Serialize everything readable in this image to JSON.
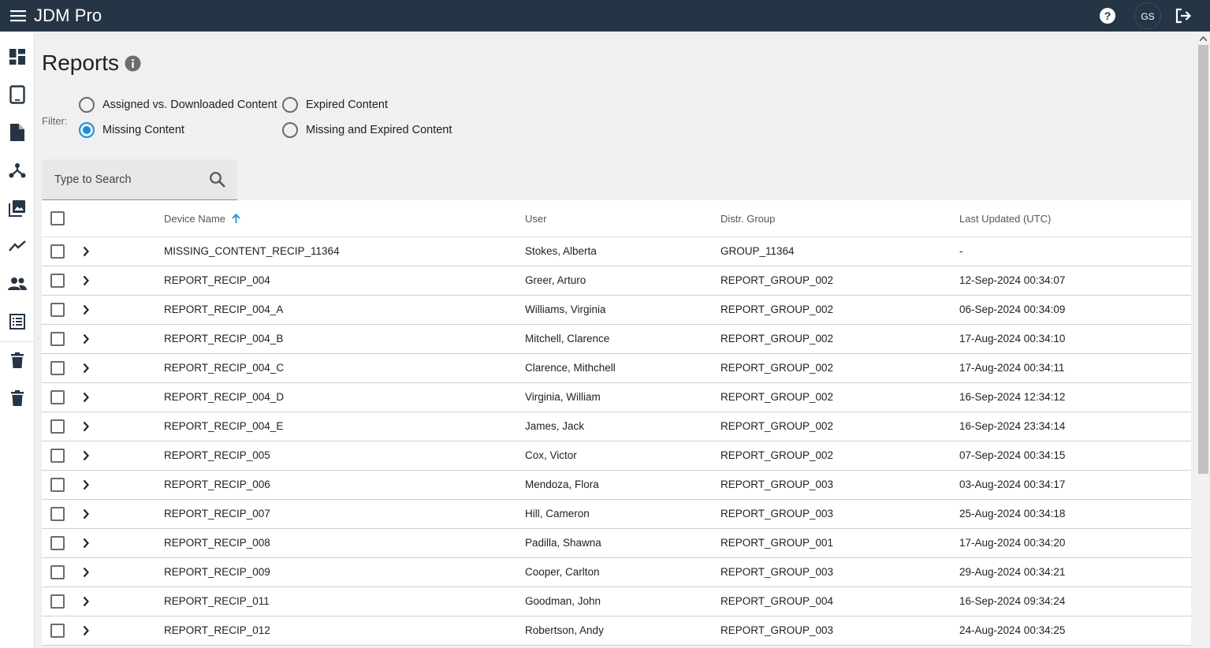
{
  "app": {
    "title": "JDM Pro",
    "user_initials": "GS"
  },
  "topbar": {
    "icons": [
      "menu-icon",
      "help-icon",
      "logout-icon"
    ]
  },
  "sidebar": {
    "items": [
      {
        "name": "dashboard",
        "icon": "dashboard-icon"
      },
      {
        "name": "devices",
        "icon": "tablet-icon"
      },
      {
        "name": "content",
        "icon": "document-icon"
      },
      {
        "name": "distribution",
        "icon": "hub-icon"
      },
      {
        "name": "media",
        "icon": "photo-library-icon"
      },
      {
        "name": "reports",
        "icon": "trending-icon"
      },
      {
        "name": "users",
        "icon": "people-icon"
      },
      {
        "name": "logs",
        "icon": "list-icon"
      },
      {
        "name": "trash-1",
        "icon": "trash-icon"
      },
      {
        "name": "trash-2",
        "icon": "trash-icon"
      }
    ]
  },
  "page": {
    "title": "Reports"
  },
  "filter": {
    "label": "Filter:",
    "options": [
      {
        "label": "Assigned vs. Downloaded Content",
        "selected": false
      },
      {
        "label": "Expired Content",
        "selected": false
      },
      {
        "label": "Missing Content",
        "selected": true
      },
      {
        "label": "Missing and Expired Content",
        "selected": false
      }
    ]
  },
  "search": {
    "placeholder": "Type to Search",
    "value": ""
  },
  "table": {
    "columns": [
      "Device Name",
      "User",
      "Distr. Group",
      "Last Updated (UTC)"
    ],
    "sort": {
      "column": "Device Name",
      "direction": "ascending"
    },
    "rows": [
      [
        "MISSING_CONTENT_RECIP_11364",
        "Stokes, Alberta",
        "GROUP_11364",
        "-"
      ],
      [
        "REPORT_RECIP_004",
        "Greer, Arturo",
        "REPORT_GROUP_002",
        "12-Sep-2024 00:34:07"
      ],
      [
        "REPORT_RECIP_004_A",
        "Williams, Virginia",
        "REPORT_GROUP_002",
        "06-Sep-2024 00:34:09"
      ],
      [
        "REPORT_RECIP_004_B",
        "Mitchell, Clarence",
        "REPORT_GROUP_002",
        "17-Aug-2024 00:34:10"
      ],
      [
        "REPORT_RECIP_004_C",
        "Clarence, Mithchell",
        "REPORT_GROUP_002",
        "17-Aug-2024 00:34:11"
      ],
      [
        "REPORT_RECIP_004_D",
        "Virginia, William",
        "REPORT_GROUP_002",
        "16-Sep-2024 12:34:12"
      ],
      [
        "REPORT_RECIP_004_E",
        "James, Jack",
        "REPORT_GROUP_002",
        "16-Sep-2024 23:34:14"
      ],
      [
        "REPORT_RECIP_005",
        "Cox, Victor",
        "REPORT_GROUP_002",
        "07-Sep-2024 00:34:15"
      ],
      [
        "REPORT_RECIP_006",
        "Mendoza, Flora",
        "REPORT_GROUP_003",
        "03-Aug-2024 00:34:17"
      ],
      [
        "REPORT_RECIP_007",
        "Hill, Cameron",
        "REPORT_GROUP_003",
        "25-Aug-2024 00:34:18"
      ],
      [
        "REPORT_RECIP_008",
        "Padilla, Shawna",
        "REPORT_GROUP_001",
        "17-Aug-2024 00:34:20"
      ],
      [
        "REPORT_RECIP_009",
        "Cooper, Carlton",
        "REPORT_GROUP_003",
        "29-Aug-2024 00:34:21"
      ],
      [
        "REPORT_RECIP_011",
        "Goodman, John",
        "REPORT_GROUP_004",
        "16-Sep-2024 09:34:24"
      ],
      [
        "REPORT_RECIP_012",
        "Robertson, Andy",
        "REPORT_GROUP_003",
        "24-Aug-2024 00:34:25"
      ]
    ]
  },
  "colors": {
    "topbar": "#263545",
    "accent": "#1a8fd8",
    "background": "#f0f0f0"
  }
}
